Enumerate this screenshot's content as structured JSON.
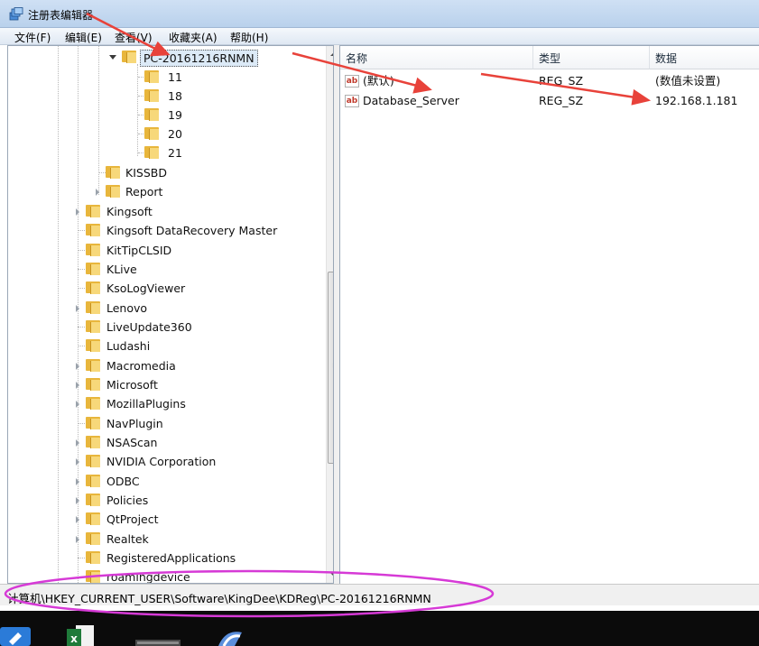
{
  "window": {
    "title": "注册表编辑器",
    "app_icon": "regedit-icon"
  },
  "menu": [
    "文件(F)",
    "编辑(E)",
    "查看(V)",
    "收藏夹(A)",
    "帮助(H)"
  ],
  "tree": {
    "selected": "PC-20161216RNMN",
    "children": [
      "11",
      "18",
      "19",
      "20",
      "21"
    ],
    "siblings": [
      "KISSBD",
      "Report"
    ],
    "software_keys": [
      "Kingsoft",
      "Kingsoft DataRecovery Master",
      "KitTipCLSID",
      "KLive",
      "KsoLogViewer",
      "Lenovo",
      "LiveUpdate360",
      "Ludashi",
      "Macromedia",
      "Microsoft",
      "MozillaPlugins",
      "NavPlugin",
      "NSAScan",
      "NVIDIA Corporation",
      "ODBC",
      "Policies",
      "QtProject",
      "Realtek",
      "RegisteredApplications",
      "roamingdevice"
    ]
  },
  "columns": {
    "name": "名称",
    "type": "类型",
    "data": "数据"
  },
  "values": [
    {
      "name": "(默认)",
      "type": "REG_SZ",
      "data": "(数值未设置)"
    },
    {
      "name": "Database_Server",
      "type": "REG_SZ",
      "data": "192.168.1.181"
    }
  ],
  "statusbar": {
    "path": "计算机\\HKEY_CURRENT_USER\\Software\\KingDee\\KDReg\\PC-20161216RNMN"
  },
  "taskbar": {
    "icons": [
      "pen-app-icon",
      "excel-icon",
      "monitor-icon",
      "browser-icon"
    ]
  },
  "annotation_colors": {
    "arrow": "#e8423a",
    "highlight_ellipse": "#d63ad6"
  }
}
